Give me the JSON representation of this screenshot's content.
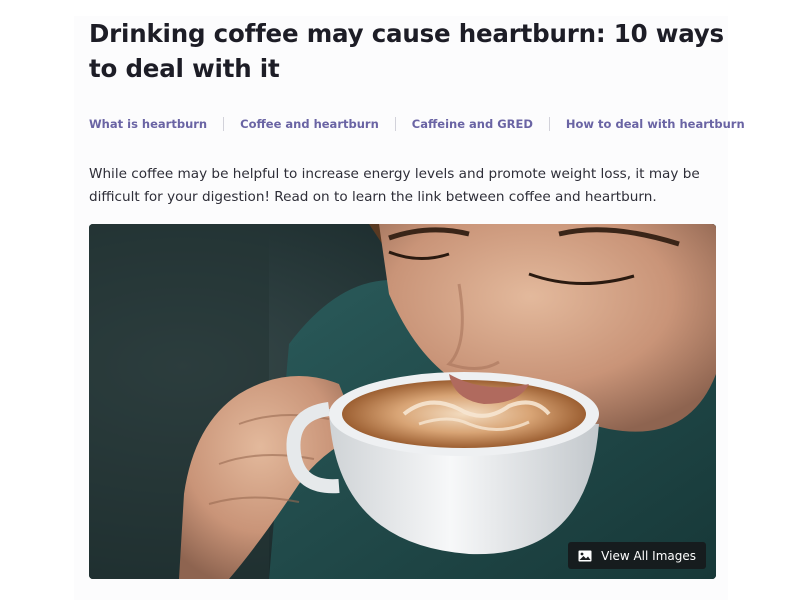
{
  "article": {
    "title": "Drinking coffee may cause heartburn: 10 ways to deal with it",
    "toc": [
      "What is heartburn",
      "Coffee and heartburn",
      "Caffeine and GRED",
      "How to deal with heartburn"
    ],
    "intro": "While coffee may be helpful to increase energy levels and promote weight loss, it may be difficult for your digestion! Read on to learn the link between coffee and heartburn.",
    "hero": {
      "view_all_label": "View All Images",
      "view_all_icon": "image-icon"
    }
  },
  "colors": {
    "title": "#1d1d26",
    "toc_link": "#6a64a4",
    "body_text": "#2e2e38"
  }
}
